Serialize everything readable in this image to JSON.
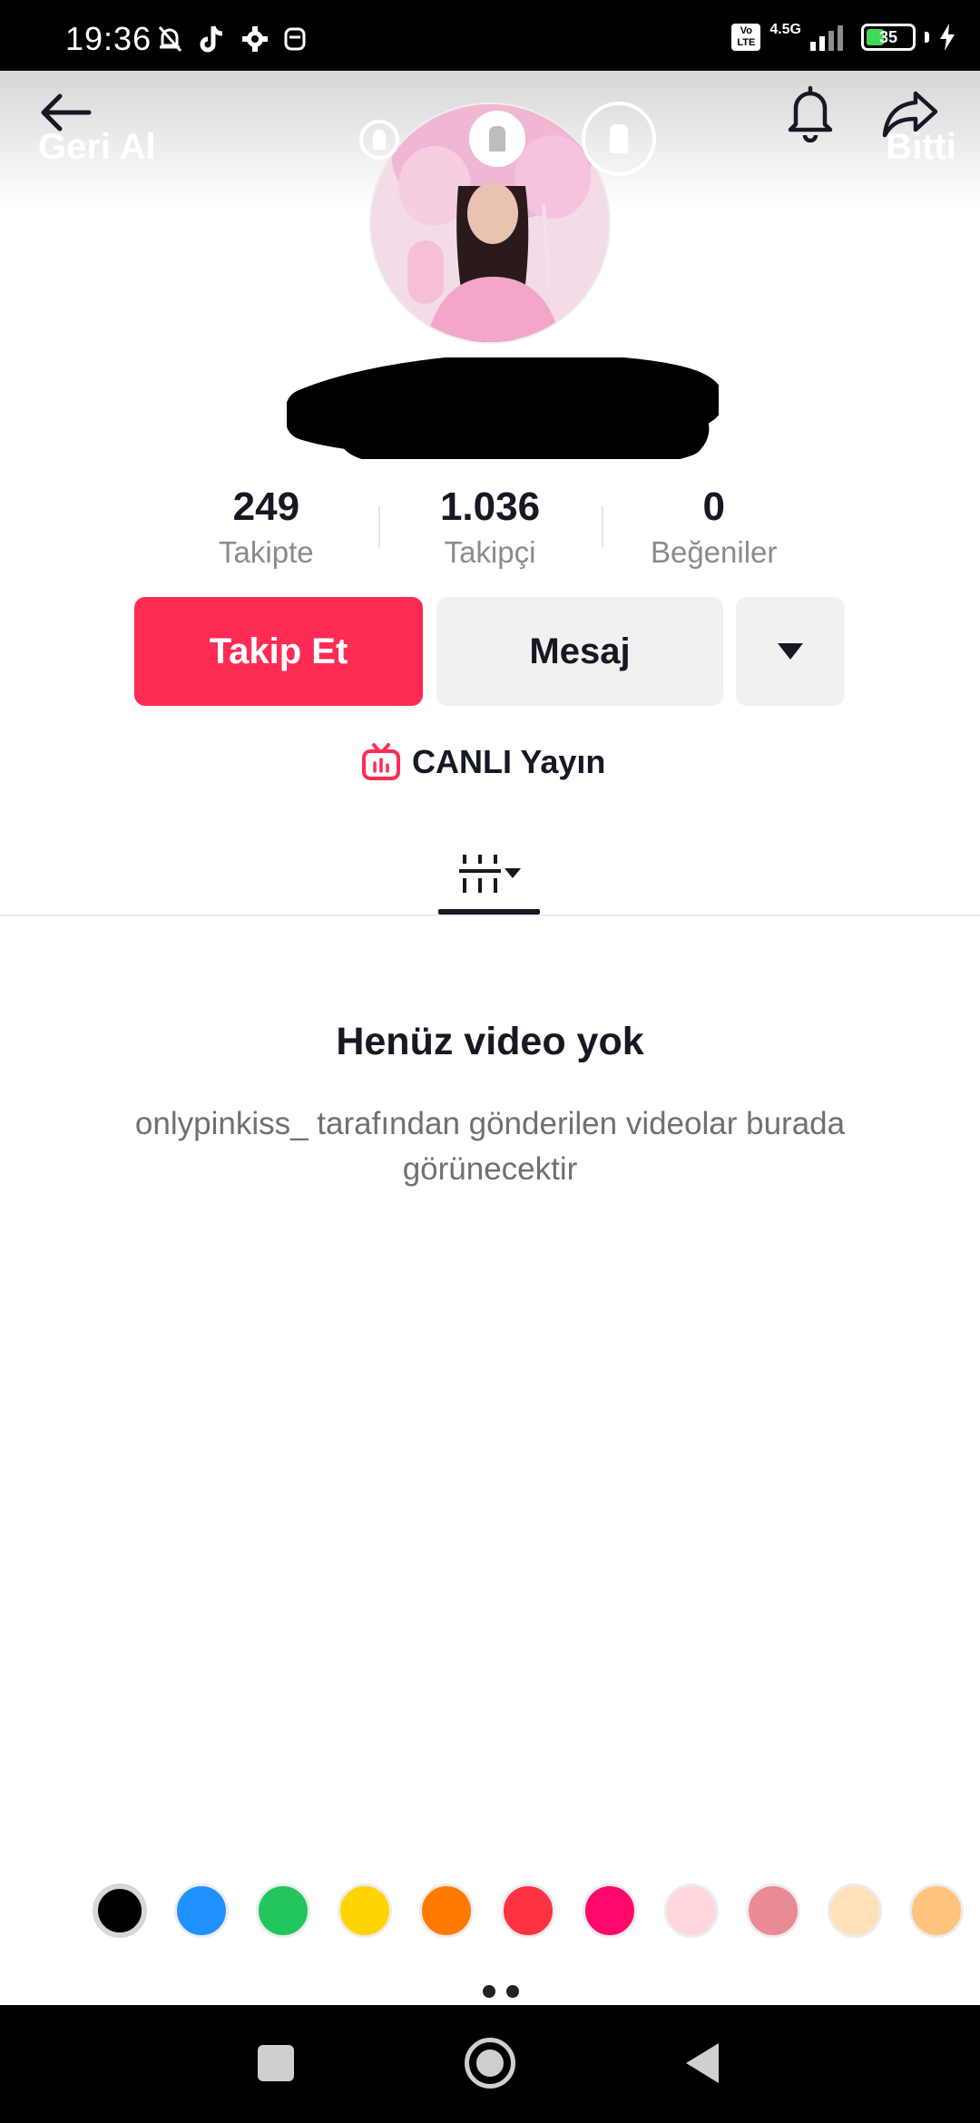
{
  "status_bar": {
    "time": "19:36",
    "network_badge": "Vo LTE",
    "network_type": "4.5G",
    "battery": "35"
  },
  "overlay": {
    "undo_label": "Geri Al",
    "done_label": "Bitti"
  },
  "profile": {
    "stats": [
      {
        "value": "249",
        "label": "Takipte"
      },
      {
        "value": "1.036",
        "label": "Takipçi"
      },
      {
        "value": "0",
        "label": "Beğeniler"
      }
    ],
    "follow_label": "Takip Et",
    "message_label": "Mesaj",
    "live_label": "CANLI Yayın"
  },
  "empty_state": {
    "title": "Henüz video yok",
    "description": "onlypinkiss_ tarafından gönderilen videolar burada görünecektir"
  },
  "palette": {
    "colors": [
      "#000000",
      "#1e90ff",
      "#22c55e",
      "#ffd400",
      "#ff7a00",
      "#ff3344",
      "#ff0a6c",
      "#ffd6dc",
      "#ea8a94",
      "#ffe0b8",
      "#ffc37e"
    ]
  },
  "icons": {
    "back": "arrow-left-icon",
    "bell": "bell-icon",
    "share": "share-arrow-icon",
    "live": "live-tv-icon",
    "grid": "video-grid-icon"
  },
  "colors": {
    "accent": "#fe2c55",
    "status_bar": "#000000",
    "secondary_button": "#f1f1f2"
  }
}
